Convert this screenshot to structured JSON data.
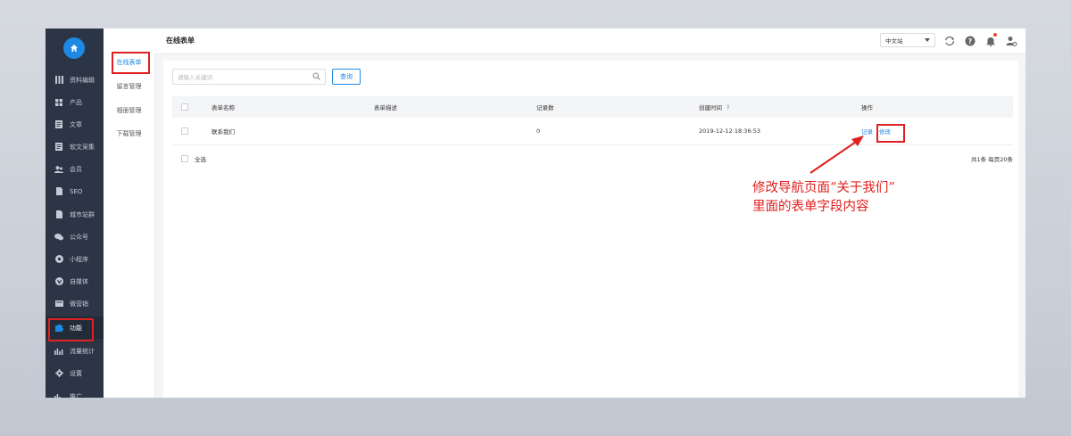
{
  "sidebar": {
    "items": [
      {
        "icon": "columns-icon",
        "label": "资料编辑"
      },
      {
        "icon": "grid-icon",
        "label": "产品"
      },
      {
        "icon": "document-icon",
        "label": "文章"
      },
      {
        "icon": "document-icon",
        "label": "软文采集"
      },
      {
        "icon": "users-icon",
        "label": "会员"
      },
      {
        "icon": "file-icon",
        "label": "SEO"
      },
      {
        "icon": "file-icon",
        "label": "城市站群"
      },
      {
        "icon": "wechat-icon",
        "label": "公众号"
      },
      {
        "icon": "mini-program-icon",
        "label": "小程序"
      },
      {
        "icon": "media-icon",
        "label": "自媒体"
      },
      {
        "icon": "marketing-icon",
        "label": "微营销"
      },
      {
        "icon": "puzzle-icon",
        "label": "功能"
      },
      {
        "icon": "bar-chart-icon",
        "label": "流量统计"
      },
      {
        "icon": "gear-icon",
        "label": "设置"
      },
      {
        "icon": "bar-chart-icon",
        "label": "推广"
      }
    ],
    "active_index": 11
  },
  "subnav": {
    "items": [
      "在线表单",
      "留言管理",
      "相册管理",
      "下载管理"
    ],
    "active_index": 0
  },
  "header": {
    "title": "在线表单",
    "language": "中文站",
    "colors": {
      "accent": "#1e88e5",
      "sidebar": "#2b3545",
      "annotation": "#e02020"
    }
  },
  "search": {
    "placeholder": "请输入关键词",
    "button": "查询"
  },
  "table": {
    "columns": [
      "表单名称",
      "表单描述",
      "记录数",
      "创建时间",
      "操作"
    ],
    "sort_indicator": "⇕",
    "rows": [
      {
        "name": "联系我们",
        "description": "",
        "count": "0",
        "created": "2019-12-12 18:36:53",
        "actions": [
          "记录",
          "修改"
        ]
      }
    ],
    "select_all": "全选",
    "summary": "共1条 每页20条"
  },
  "annotation": {
    "line1": "修改导航页面“关于我们”",
    "line2": "里面的表单字段内容"
  }
}
